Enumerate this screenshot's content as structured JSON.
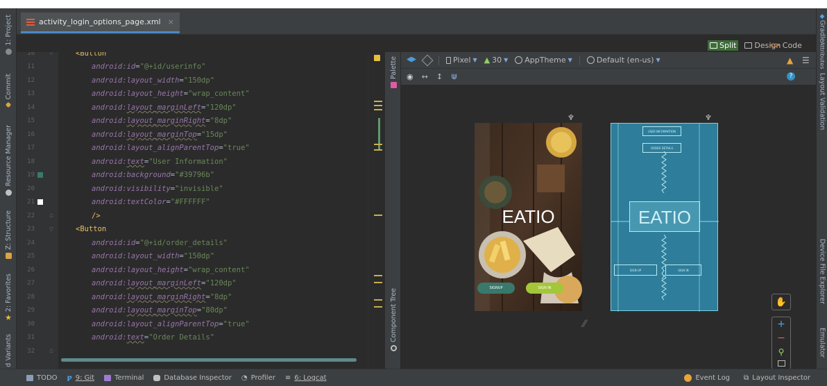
{
  "editor_tab": {
    "filename": "activity_login_options_page.xml",
    "close_glyph": "×"
  },
  "left_tools": [
    "1: Project",
    "Commit",
    "Resource Manager",
    "Z: Structure",
    "2: Favorites",
    "d Variants"
  ],
  "right_tools": [
    "Gradle",
    "Layout Validation",
    "Device File Explorer",
    "Emulator"
  ],
  "view_modes": {
    "code": "Code",
    "split": "Split",
    "design": "Design",
    "active": "split"
  },
  "design_toolbar": {
    "device": "Pixel",
    "api": "30",
    "theme": "AppTheme",
    "locale": "Default (en-us)"
  },
  "side_panels": {
    "palette": "Palette",
    "component_tree": "Component Tree",
    "attributes": "Attributes"
  },
  "code_lines": [
    {
      "n": "10",
      "code": "<Button",
      "partial": true
    },
    {
      "n": "11",
      "attr": "android:id",
      "val": "\"@+id/userinfo\""
    },
    {
      "n": "12",
      "attr": "android:layout_width",
      "val": "\"150dp\""
    },
    {
      "n": "13",
      "attr": "android:layout_height",
      "val": "\"wrap_content\""
    },
    {
      "n": "14",
      "attr": "android:layout_marginLeft",
      "val": "\"120dp\""
    },
    {
      "n": "15",
      "attr": "android:layout_marginRight",
      "val": "\"8dp\""
    },
    {
      "n": "16",
      "attr": "android:layout_marginTop",
      "val": "\"15dp\""
    },
    {
      "n": "17",
      "attr": "android:layout_alignParentTop",
      "val": "\"true\""
    },
    {
      "n": "18",
      "attr": "android:text",
      "val": "\"User Information\""
    },
    {
      "n": "19",
      "attr": "android:background",
      "val": "\"#39796b\""
    },
    {
      "n": "20",
      "attr": "android:visibility",
      "val": "\"invisible\""
    },
    {
      "n": "21",
      "attr": "android:textColor",
      "val": "\"#FFFFFF\""
    },
    {
      "n": "22",
      "code": "/>"
    },
    {
      "n": "23",
      "code": "<Button"
    },
    {
      "n": "24",
      "attr": "android:id",
      "val": "\"@+id/order_details\""
    },
    {
      "n": "25",
      "attr": "android:layout_width",
      "val": "\"150dp\""
    },
    {
      "n": "26",
      "attr": "android:layout_height",
      "val": "\"wrap_content\""
    },
    {
      "n": "27",
      "attr": "android:layout_marginLeft",
      "val": "\"120dp\""
    },
    {
      "n": "28",
      "attr": "android:layout_marginRight",
      "val": "\"8dp\""
    },
    {
      "n": "29",
      "attr": "android:layout_marginTop",
      "val": "\"80dp\""
    },
    {
      "n": "30",
      "attr": "android:layout_alignParentTop",
      "val": "\"true\""
    },
    {
      "n": "31",
      "attr": "android:text",
      "val": "\"Order Details\""
    },
    {
      "n": "32",
      "code": ""
    }
  ],
  "gutter_swatches": {
    "19": "#39796b",
    "21": "#FFFFFF"
  },
  "preview": {
    "title": "EATIO",
    "signup": "SIGNUP",
    "signin": "SIGN IN",
    "signup_color": "#39796b",
    "signin_color": "#a4c639"
  },
  "blueprint": {
    "title": "EATIO",
    "btn1": "USER INFORMATION",
    "btn2": "ORDER DETAILS",
    "btn3": "SIGN UP",
    "btn4": "SIGN IN"
  },
  "bottom_bar": {
    "todo": "TODO",
    "git": "9: Git",
    "terminal": "Terminal",
    "db": "Database Inspector",
    "profiler": "Profiler",
    "logcat": "6: Logcat",
    "event_log": "Event Log",
    "layout_inspector": "Layout Inspector"
  }
}
